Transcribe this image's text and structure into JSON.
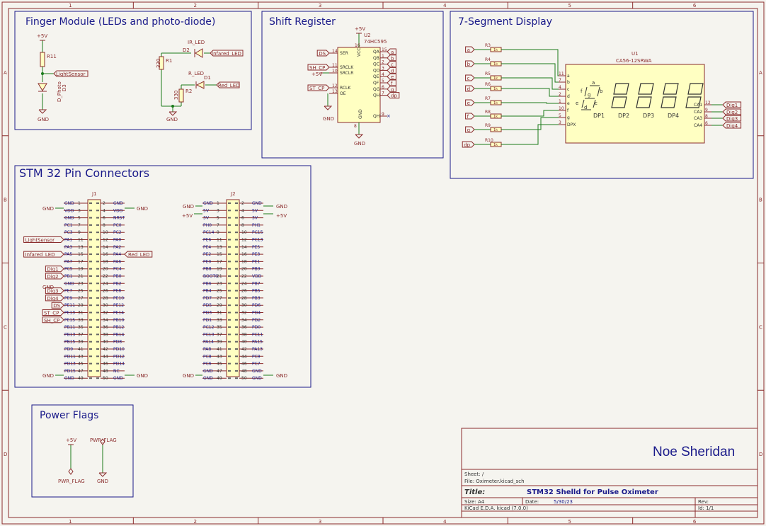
{
  "frame": {
    "cols": [
      "1",
      "2",
      "3",
      "4",
      "5",
      "6"
    ],
    "rows": [
      "A",
      "B",
      "C",
      "D"
    ]
  },
  "colors": {
    "frame": "#8a2c2c",
    "wire": "#1a7a1a",
    "box": "#1a1a8a",
    "part_fill": "#ffffc2",
    "label": "#8a2c2c",
    "junction": "#1a7a1a"
  },
  "blocks": {
    "finger": {
      "title": "Finger Module (LEDs and photo-diode)"
    },
    "shift": {
      "title": "Shift Register"
    },
    "seg": {
      "title": "7-Segment Display"
    },
    "stm": {
      "title": "STM 32 Pin Connectors"
    },
    "power": {
      "title": "Power Flags"
    }
  },
  "finger": {
    "vcc": "+5V",
    "gnd1": "GND",
    "gnd2": "GND",
    "r11": "R11",
    "r1": "R1",
    "r1v": "330",
    "r2": "R2",
    "r2v": "330",
    "d3": "D3",
    "d3v": "D_Photo",
    "d2": "D2",
    "d2v": "IR_LED",
    "d1": "D1",
    "d1v": "R_LED",
    "lbl_light": "LightSensor",
    "lbl_ir": "Infared_LED",
    "lbl_red": "Red_LED"
  },
  "shift": {
    "ref": "U2",
    "value": "74HC595",
    "vcc": "+5V",
    "vcc2": "+5V",
    "gnd": "GND",
    "gnd2": "GND",
    "pins_left": [
      {
        "num": "14",
        "name": "SER",
        "label": "DS"
      },
      {
        "num": "11",
        "name": "SRCLK",
        "label": "SH_CP"
      },
      {
        "num": "10",
        "name": "SRCLR",
        "label": ""
      },
      {
        "num": "12",
        "name": "RCLK",
        "label": "ST_CP"
      },
      {
        "num": "13",
        "name": "OE",
        "label": ""
      }
    ],
    "pin_vcc": {
      "num": "16",
      "name": "VCC"
    },
    "pin_gnd": {
      "num": "8",
      "name": "GND"
    },
    "pins_right": [
      {
        "num": "15",
        "name": "QA",
        "label": "a"
      },
      {
        "num": "1",
        "name": "QB",
        "label": "b"
      },
      {
        "num": "2",
        "name": "QC",
        "label": "c"
      },
      {
        "num": "3",
        "name": "QD",
        "label": "d"
      },
      {
        "num": "4",
        "name": "QE",
        "label": "e"
      },
      {
        "num": "5",
        "name": "QF",
        "label": "f"
      },
      {
        "num": "6",
        "name": "QG",
        "label": "g"
      },
      {
        "num": "7",
        "name": "QH",
        "label": "dp"
      },
      {
        "num": "9",
        "name": "QH'",
        "label": ""
      }
    ]
  },
  "seg": {
    "ref": "U1",
    "value": "CA56-12SRWA",
    "seg_letters": {
      "a": "a",
      "b": "b",
      "c": "c",
      "d": "d",
      "e": "e",
      "f": "f",
      "g": "g",
      "dp": "DP"
    },
    "inputs": [
      {
        "label": "a",
        "r": "R3",
        "rv": "1k",
        "pin": "11",
        "name": "a"
      },
      {
        "label": "b",
        "r": "R4",
        "rv": "1k",
        "pin": "7",
        "name": "b"
      },
      {
        "label": "c",
        "r": "R5",
        "rv": "1k",
        "pin": "4",
        "name": "c"
      },
      {
        "label": "d",
        "r": "R6",
        "rv": "1k",
        "pin": "2",
        "name": "d"
      },
      {
        "label": "e",
        "r": "R7",
        "rv": "1k",
        "pin": "1",
        "name": "e"
      },
      {
        "label": "f",
        "r": "R8",
        "rv": "1k",
        "pin": "10",
        "name": "f"
      },
      {
        "label": "g",
        "r": "R9",
        "rv": "1k",
        "pin": "5",
        "name": "g"
      },
      {
        "label": "dp",
        "r": "R10",
        "rv": "1k",
        "pin": "3",
        "name": "DPX"
      }
    ],
    "digits": [
      "DP1",
      "DP2",
      "DP3",
      "DP4"
    ],
    "outputs": [
      {
        "pin": "12",
        "name": "CA1",
        "label": "Dig1"
      },
      {
        "pin": "9",
        "name": "CA2",
        "label": "Dig2"
      },
      {
        "pin": "8",
        "name": "CA3",
        "label": "Dig3"
      },
      {
        "pin": "6",
        "name": "CA4",
        "label": "Dig4"
      }
    ]
  },
  "j1": {
    "ref": "J1",
    "left": [
      "GND",
      "VDD",
      "GND",
      "PC1",
      "PC3",
      "PA1",
      "PA3",
      "PA5",
      "PA7",
      "PC5",
      "PB1",
      "GND",
      "PE7",
      "PE9",
      "PE11",
      "PE13",
      "PE15",
      "PB11",
      "PB13",
      "PB15",
      "PD9",
      "PD11",
      "PD13",
      "PD15",
      "GND"
    ],
    "right": [
      "GND",
      "VDD",
      "NRST",
      "PC0",
      "PC2",
      "PA0",
      "PA2",
      "PA4",
      "PA6",
      "PC4",
      "PB0",
      "PB2",
      "PE8",
      "PE10",
      "PE12",
      "PE14",
      "PB10",
      "PB12",
      "PB14",
      "PD8",
      "PD10",
      "PD12",
      "PD14",
      "NC",
      "GND"
    ],
    "left_labels": [
      {
        "row": 5,
        "text": "LightSensor"
      },
      {
        "row": 7,
        "text": "Infared_LED"
      },
      {
        "row": 9,
        "text": "Dig1"
      },
      {
        "row": 10,
        "text": "Dig2"
      },
      {
        "row": 12,
        "text": "Dig3"
      },
      {
        "row": 13,
        "text": "Dig4"
      },
      {
        "row": 14,
        "text": "DS"
      },
      {
        "row": 15,
        "text": "ST_CP"
      },
      {
        "row": 16,
        "text": "SH_CP"
      }
    ],
    "right_labels": [
      {
        "row": 7,
        "text": "Red_LED"
      }
    ],
    "gnd_l_top": "GND",
    "gnd_l_mid": "GND",
    "gnd_l_bot": "GND",
    "gnd_r_top": "GND",
    "gnd_r_bot": "GND"
  },
  "j2": {
    "ref": "J2",
    "left": [
      "GND",
      "5V",
      "3V",
      "PH0",
      "PC14",
      "PE6",
      "PE4",
      "PE2",
      "PE0",
      "PB8",
      "BOOT0",
      "PB6",
      "PB4",
      "PD7",
      "PD5",
      "PD3",
      "PD1",
      "PC12",
      "PC10",
      "PA14",
      "PA8",
      "PC8",
      "PC6",
      "GND",
      "GND"
    ],
    "right": [
      "GND",
      "5V",
      "3V",
      "PH1",
      "PC15",
      "PC13",
      "PE5",
      "PE3",
      "PE1",
      "PB9",
      "VDD",
      "PB7",
      "PB5",
      "PB3",
      "PD6",
      "PD4",
      "PD2",
      "PD0",
      "PC11",
      "PA15",
      "PA13",
      "PC9",
      "PC7",
      "GND",
      "GND"
    ],
    "gnd_l": "GND",
    "vcc_l": "+5V",
    "gnd_r": "GND",
    "vcc_r": "+5V",
    "gnd_l_bot": "GND",
    "gnd_r_bot": "GND"
  },
  "power": {
    "vcc": "+5V",
    "vcc_flag": "PWR_FLAG",
    "gnd_flag": "PWR_FLAG",
    "gnd": "GND"
  },
  "titleblock": {
    "author": "Noe Sheridan",
    "sheet_label": "Sheet: /",
    "file_label": "File: Oximeter.kicad_sch",
    "title_label": "Title:",
    "title": "STM32 Shelld for Pulse Oximeter",
    "size_label": "Size: A4",
    "date_label": "Date:",
    "date": "5/30/23",
    "rev_label": "Rev:",
    "tool": "KiCad E.D.A.  kicad (7.0.0)",
    "id": "Id: 1/1"
  }
}
